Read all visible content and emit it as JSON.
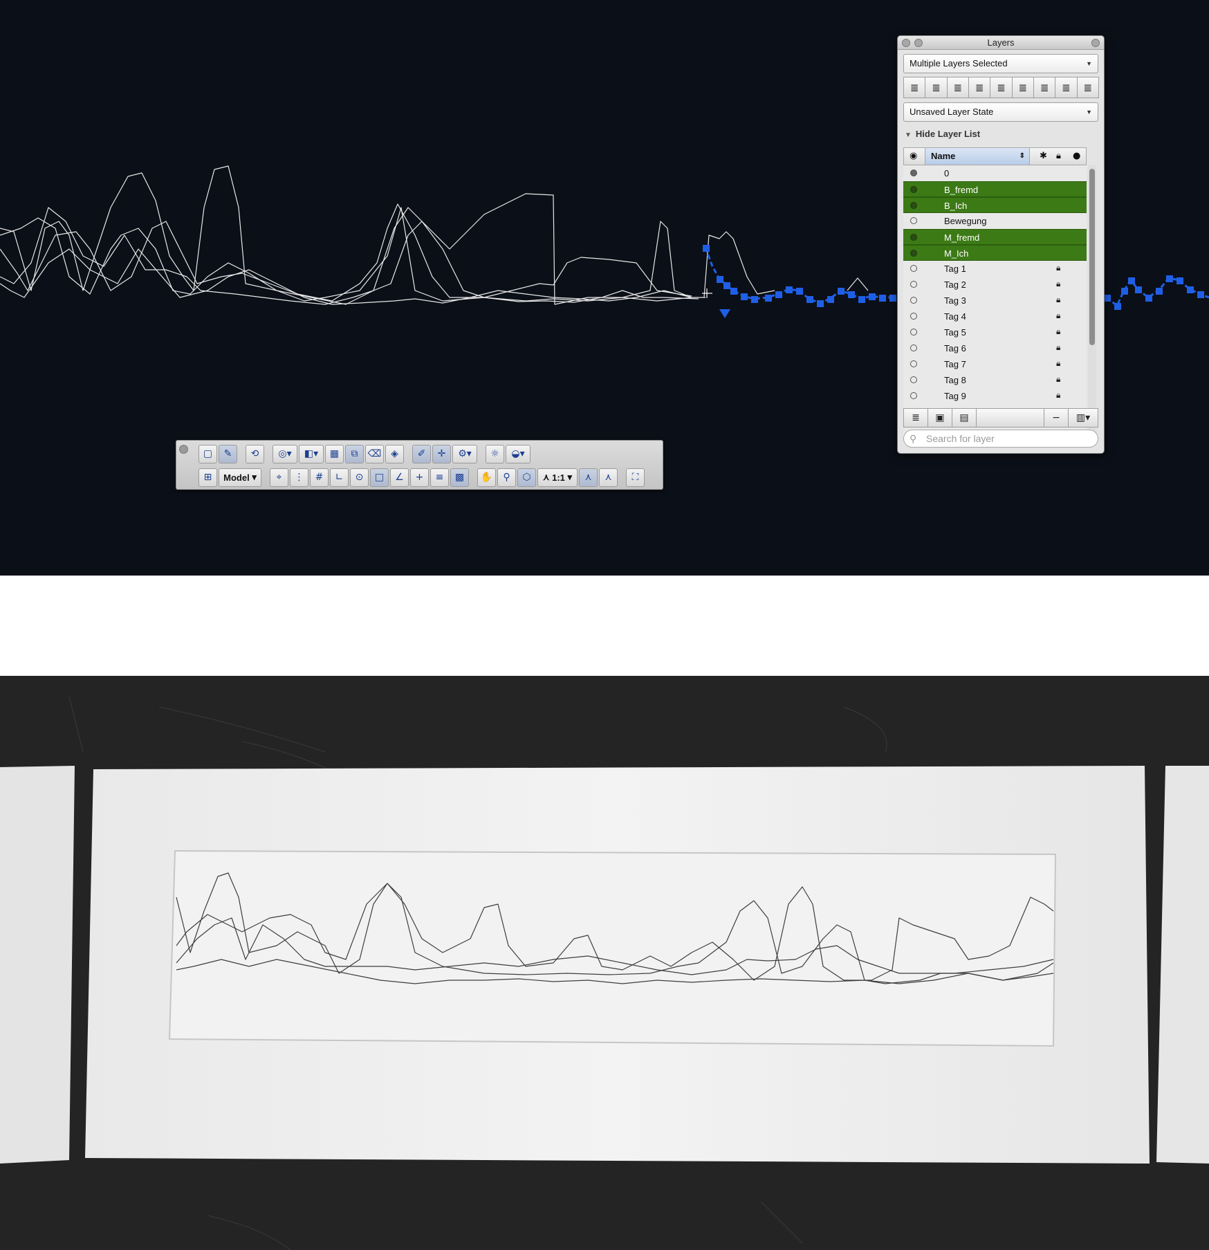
{
  "layers_panel": {
    "title": "Layers",
    "selection_dropdown": "Multiple Layers Selected",
    "state_dropdown": "Unsaved Layer State",
    "hide_list_label": "Hide Layer List",
    "column_name": "Name",
    "search_placeholder": "Search for layer",
    "rows": [
      {
        "name": "0",
        "selected": false,
        "visible_filled": true,
        "locked": false
      },
      {
        "name": "B_fremd",
        "selected": true,
        "visible_filled": true,
        "locked": false
      },
      {
        "name": "B_Ich",
        "selected": true,
        "visible_filled": true,
        "locked": false
      },
      {
        "name": "Bewegung",
        "selected": false,
        "visible_filled": false,
        "locked": false
      },
      {
        "name": "M_fremd",
        "selected": true,
        "visible_filled": true,
        "locked": false
      },
      {
        "name": "M_Ich",
        "selected": true,
        "visible_filled": true,
        "locked": false
      },
      {
        "name": "Tag 1",
        "selected": false,
        "visible_filled": false,
        "locked": true
      },
      {
        "name": "Tag 2",
        "selected": false,
        "visible_filled": false,
        "locked": true
      },
      {
        "name": "Tag 3",
        "selected": false,
        "visible_filled": false,
        "locked": true
      },
      {
        "name": "Tag 4",
        "selected": false,
        "visible_filled": false,
        "locked": true
      },
      {
        "name": "Tag 5",
        "selected": false,
        "visible_filled": false,
        "locked": true
      },
      {
        "name": "Tag 6",
        "selected": false,
        "visible_filled": false,
        "locked": true
      },
      {
        "name": "Tag 7",
        "selected": false,
        "visible_filled": false,
        "locked": true
      },
      {
        "name": "Tag 8",
        "selected": false,
        "visible_filled": false,
        "locked": true
      },
      {
        "name": "Tag 9",
        "selected": false,
        "visible_filled": false,
        "locked": true
      }
    ],
    "selected_row_color": "#3c7a16"
  },
  "toolbar": {
    "view_label": "Model",
    "scale_label": "1:1"
  },
  "colors": {
    "viewport_bg": "#0b0f17",
    "selection_blue": "#1f5fe6"
  }
}
